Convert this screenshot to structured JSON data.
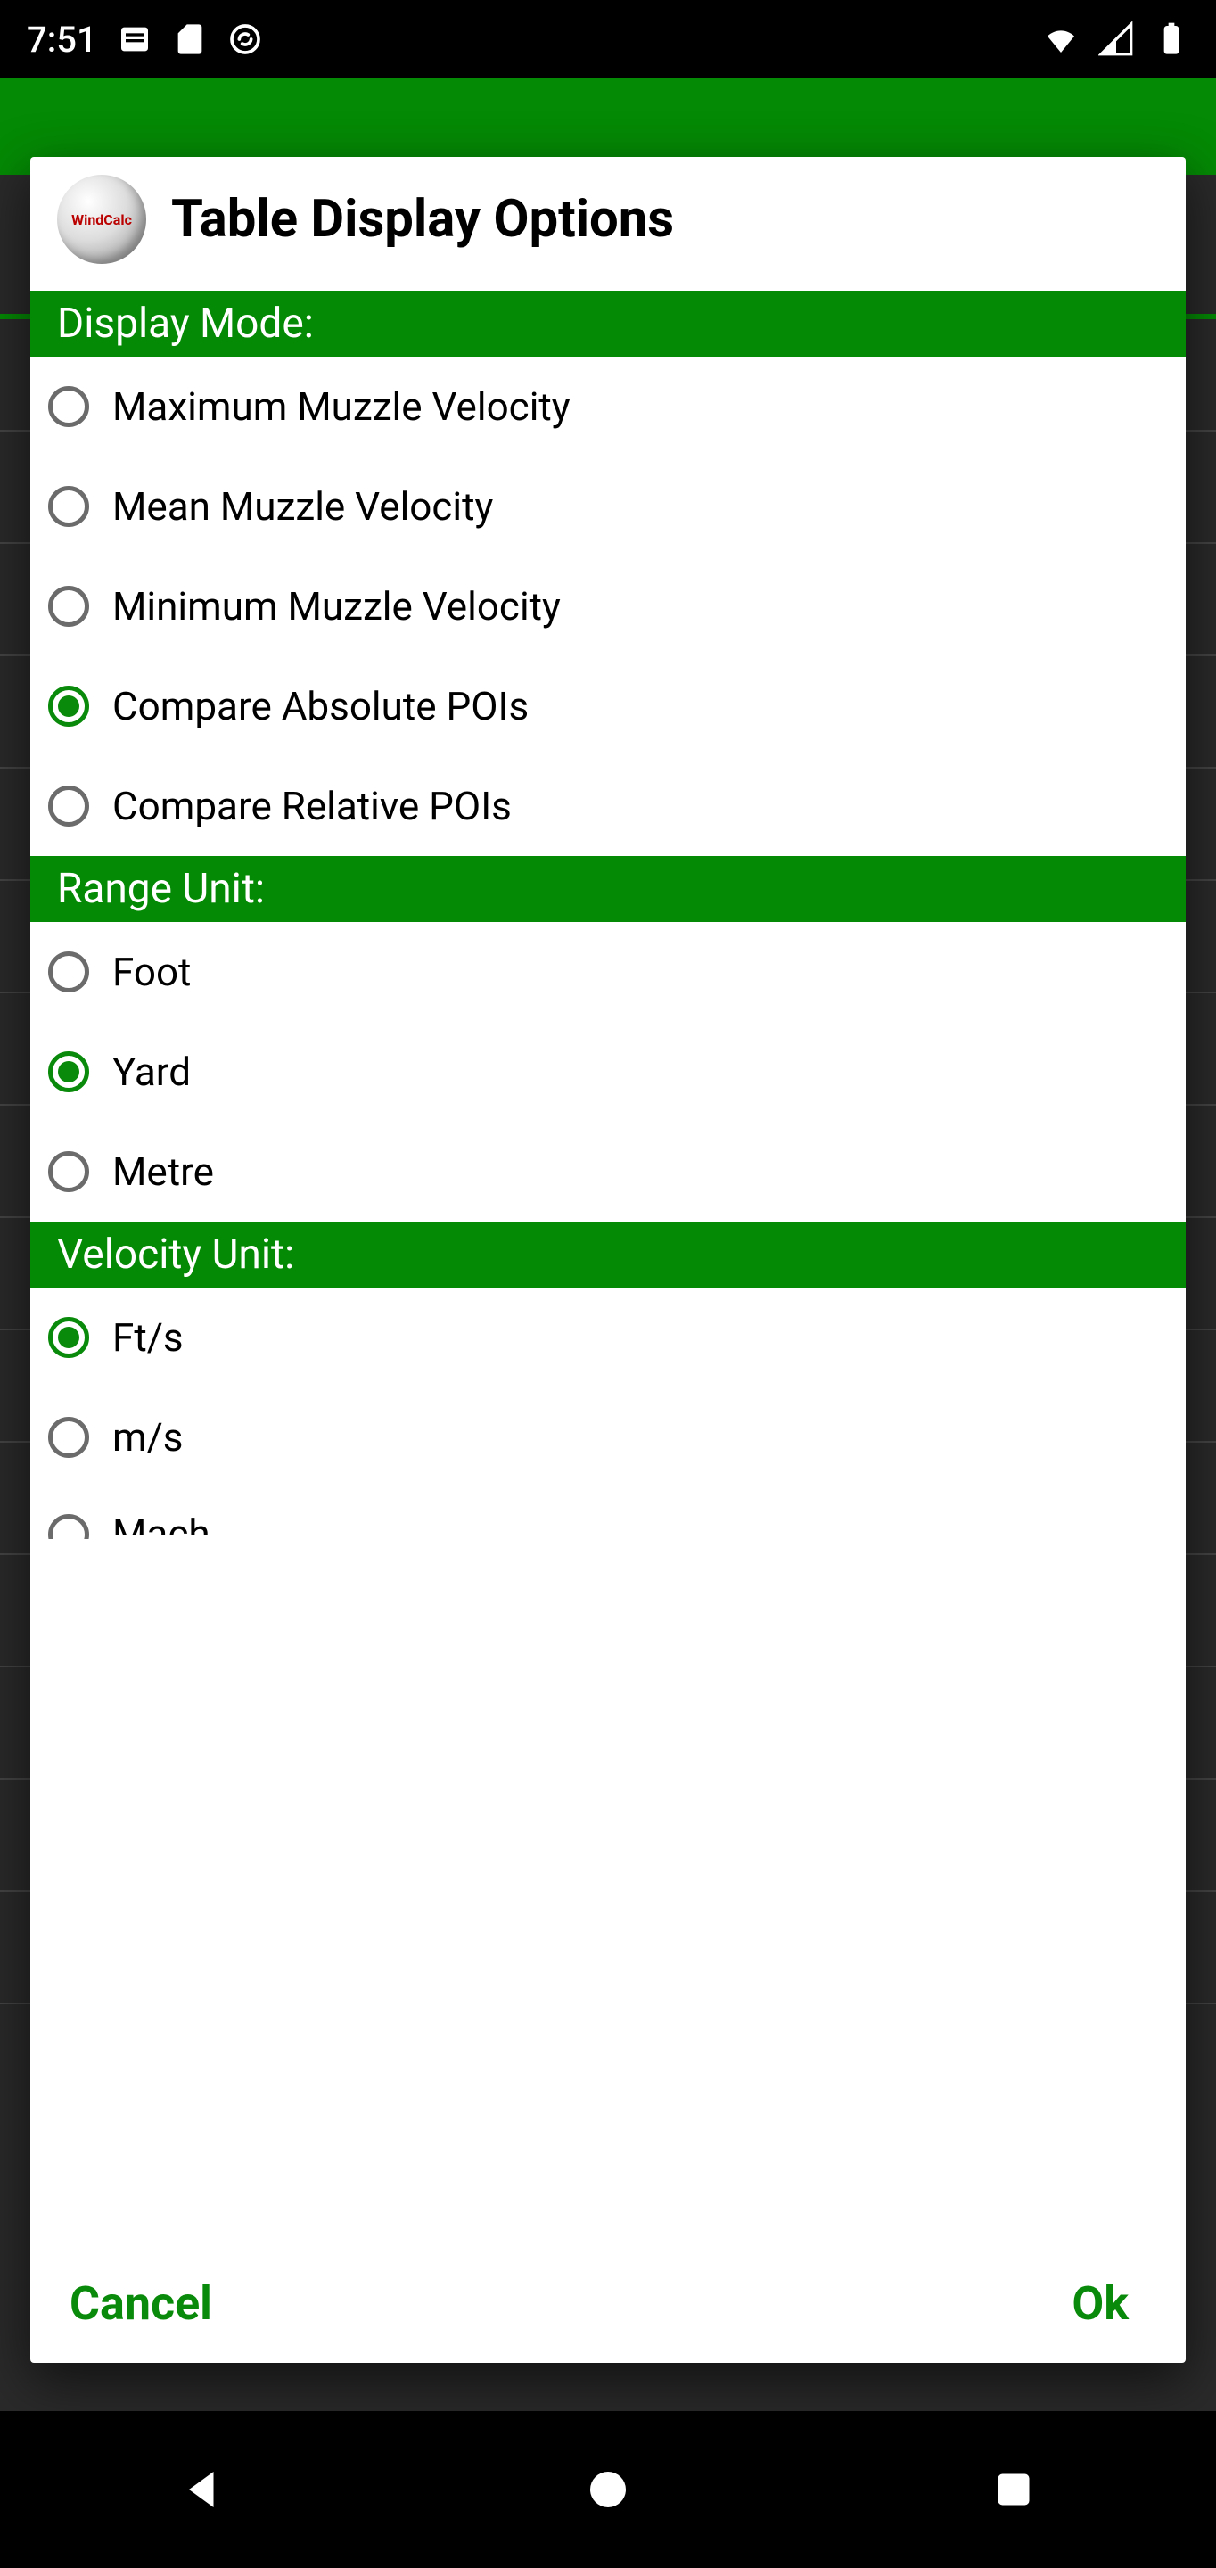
{
  "status": {
    "time": "7:51"
  },
  "dialog": {
    "appIconText": "WindCalc",
    "title": "Table Display Options",
    "sections": {
      "displayMode": {
        "header": "Display Mode:",
        "options": [
          {
            "label": "Maximum Muzzle Velocity",
            "checked": false
          },
          {
            "label": "Mean Muzzle Velocity",
            "checked": false
          },
          {
            "label": "Minimum Muzzle Velocity",
            "checked": false
          },
          {
            "label": "Compare Absolute POIs",
            "checked": true
          },
          {
            "label": "Compare Relative POIs",
            "checked": false
          }
        ]
      },
      "rangeUnit": {
        "header": "Range Unit:",
        "options": [
          {
            "label": "Foot",
            "checked": false
          },
          {
            "label": "Yard",
            "checked": true
          },
          {
            "label": "Metre",
            "checked": false
          }
        ]
      },
      "velocityUnit": {
        "header": "Velocity Unit:",
        "options": [
          {
            "label": "Ft/s",
            "checked": true
          },
          {
            "label": "m/s",
            "checked": false
          },
          {
            "label": "Mach",
            "checked": false
          }
        ]
      }
    },
    "footer": {
      "cancel": "Cancel",
      "ok": "Ok"
    }
  }
}
